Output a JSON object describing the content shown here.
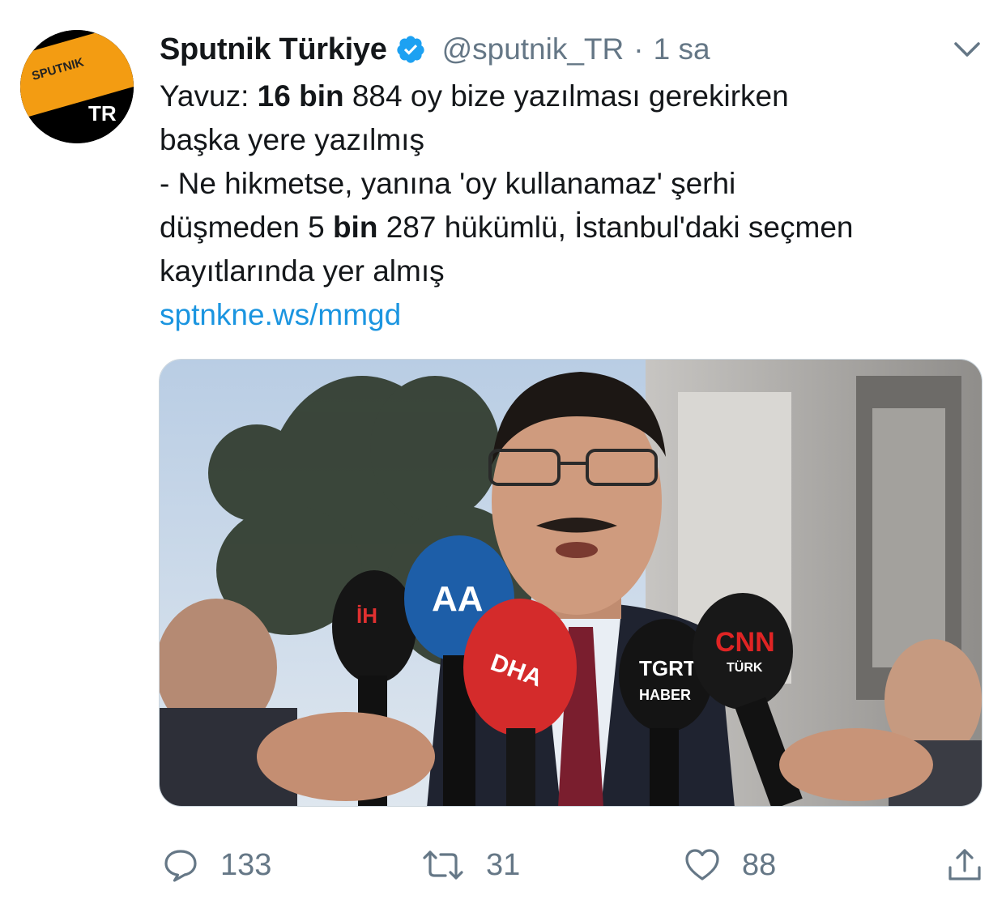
{
  "tweet": {
    "author_name": "Sputnik Türkiye",
    "handle": "@sputnik_TR",
    "separator": "·",
    "time": "1 sa",
    "avatar": {
      "top_text": "SPUTNIK",
      "bottom_text": "TR"
    },
    "text_lines": [
      [
        {
          "t": "Yavuz: "
        },
        {
          "t": "16 bin",
          "b": true
        },
        {
          "t": " 884 oy bize yazılması gerekirken"
        }
      ],
      [
        {
          "t": "başka yere yazılmış"
        }
      ],
      [
        {
          "t": "- Ne hikmetse, yanına 'oy kullanamaz' şerhi"
        }
      ],
      [
        {
          "t": "düşmeden 5 "
        },
        {
          "t": "bin",
          "b": true
        },
        {
          "t": " 287 hükümlü, İstanbul'daki seçmen"
        }
      ],
      [
        {
          "t": "kayıtlarında yer almış"
        }
      ]
    ],
    "link": "sptnkne.ws/mmgd",
    "media": {
      "mic_labels": [
        "AA",
        "DHA",
        "İH",
        "TGRT",
        "HABER",
        "CNN",
        "TÜRK"
      ]
    },
    "stats": {
      "replies": "133",
      "retweets": "31",
      "likes": "88"
    }
  },
  "colors": {
    "link": "#1b95e0",
    "secondary": "#657786",
    "verified": "#1da1f2",
    "sputnik_orange": "#f39c12"
  },
  "icons": {
    "verified": "verified-badge-icon",
    "more": "chevron-down-icon",
    "reply": "reply-icon",
    "retweet": "retweet-icon",
    "like": "heart-icon",
    "share": "share-icon"
  }
}
